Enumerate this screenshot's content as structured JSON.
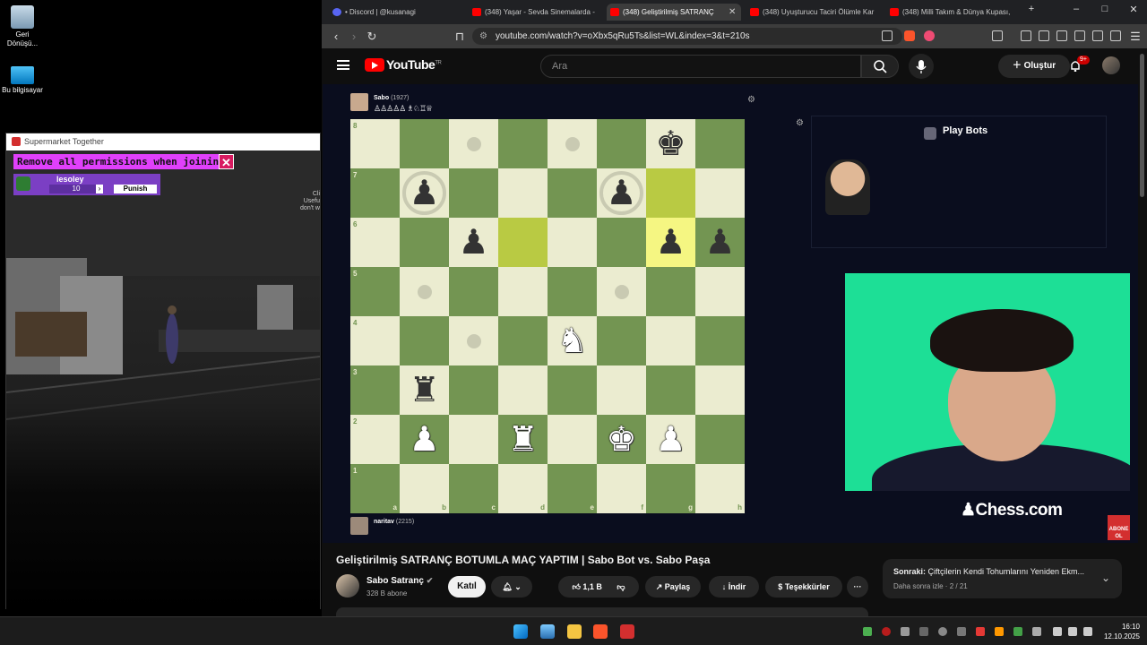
{
  "desktop": {
    "icons": [
      {
        "label": "Geri Dönüşü...",
        "icon": "recycle-bin-icon"
      },
      {
        "label": "Bu bilgisayar",
        "icon": "computer-icon"
      }
    ]
  },
  "game_window": {
    "title": "Supermarket Together",
    "permissions_label": "Remove all permissions when joining",
    "close_symbol": "✕",
    "player": {
      "name": "lesoley",
      "count": "10",
      "punish_label": "Punish"
    },
    "side_text": "Cli\nUsefu\ndon't w"
  },
  "browser": {
    "tabs": [
      {
        "label": "• Discord | @kusanagi",
        "active": false
      },
      {
        "label": "(348) Yaşar - Sevda Sinemalarda -",
        "active": false
      },
      {
        "label": "(348) Geliştirilmiş SATRANÇ",
        "active": true
      },
      {
        "label": "(348) Uyuşturucu Taciri Ölümle Kar",
        "active": false
      },
      {
        "label": "(348) Milli Takım & Dünya Kupası,",
        "active": false
      }
    ],
    "new_tab": "+",
    "url": "youtube.com/watch?v=oXbx5qRu5Ts&list=WL&index=3&t=210s"
  },
  "youtube": {
    "logo_text": "YouTube",
    "logo_region": "TR",
    "search_placeholder": "Ara",
    "create_label": "Oluştur",
    "notif_count": "9+"
  },
  "video": {
    "top_player": {
      "name": "Sabo",
      "rating": "(1927)"
    },
    "bottom_player": {
      "name": "naritav",
      "rating": "(2215)"
    },
    "board": {
      "light_color": "#ebecd0",
      "dark_color": "#739552",
      "ranks": [
        "8",
        "7",
        "6",
        "5",
        "4",
        "3",
        "2",
        "1"
      ],
      "files": [
        "a",
        "b",
        "c",
        "d",
        "e",
        "f",
        "g",
        "h"
      ],
      "highlights": [
        {
          "sq": "d6",
          "kind": "dim"
        },
        {
          "sq": "g7",
          "kind": "dim"
        },
        {
          "sq": "g6",
          "kind": "bright"
        }
      ],
      "pieces": [
        {
          "sq": "g8",
          "glyph": "♚",
          "color": "b",
          "name": "black-king"
        },
        {
          "sq": "b7",
          "glyph": "♟",
          "color": "b",
          "name": "black-pawn"
        },
        {
          "sq": "f7",
          "glyph": "♟",
          "color": "b",
          "name": "black-pawn"
        },
        {
          "sq": "c6",
          "glyph": "♟",
          "color": "b",
          "name": "black-pawn"
        },
        {
          "sq": "g6",
          "glyph": "♟",
          "color": "b",
          "name": "black-pawn"
        },
        {
          "sq": "h6",
          "glyph": "♟",
          "color": "b",
          "name": "black-pawn"
        },
        {
          "sq": "e4",
          "glyph": "♞",
          "color": "w",
          "name": "white-knight"
        },
        {
          "sq": "b3",
          "glyph": "♜",
          "color": "b",
          "name": "black-rook"
        },
        {
          "sq": "b2",
          "glyph": "♟",
          "color": "w",
          "name": "white-pawn"
        },
        {
          "sq": "d2",
          "glyph": "♜",
          "color": "w",
          "name": "white-rook"
        },
        {
          "sq": "f2",
          "glyph": "♚",
          "color": "w",
          "name": "white-king"
        },
        {
          "sq": "g2",
          "glyph": "♟",
          "color": "w",
          "name": "white-pawn"
        }
      ],
      "move_dots": [
        "c8",
        "e8",
        "b5",
        "f5",
        "c4"
      ],
      "move_rings": [
        "b7",
        "f7"
      ]
    },
    "bots_label": "Play Bots",
    "chess_logo": "Chess.com",
    "subscribe_badge": "ABONE OL"
  },
  "meta": {
    "title": "Geliştirilmiş SATRANÇ BOTUMLA MAÇ YAPTIM | Sabo Bot vs. Sabo Paşa",
    "channel": "Sabo Satranç",
    "subscribers": "328 B abone",
    "join_label": "Katıl",
    "likes": "1,1 B",
    "share_label": "Paylaş",
    "download_label": "İndir",
    "thanks_label": "Teşekkürler",
    "more_label": "···",
    "next": {
      "title_prefix": "Sonraki:",
      "title": "Çiftçilerin Kendi Tohumlarını Yeniden Ekm...",
      "subtitle": "Daha sonra izle · 2 / 21"
    }
  },
  "taskbar": {
    "time": "16:10",
    "date": "12.10.2025"
  }
}
